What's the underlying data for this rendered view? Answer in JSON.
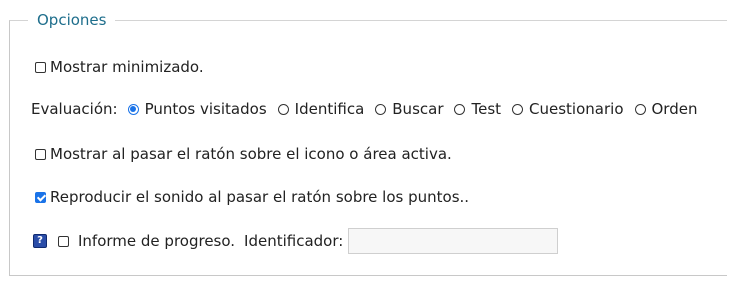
{
  "legend": "Opciones",
  "minimized": {
    "label": "Mostrar minimizado.",
    "checked": false
  },
  "evaluation": {
    "label": "Evaluación:",
    "options": [
      "Puntos visitados",
      "Identifica",
      "Buscar",
      "Test",
      "Cuestionario",
      "Orden"
    ],
    "selected": "Puntos visitados"
  },
  "hover_show": {
    "label": "Mostrar al pasar el ratón sobre el icono o área activa.",
    "checked": false
  },
  "hover_sound": {
    "label": "Reproducir el sonido al pasar el ratón sobre los puntos..",
    "checked": true
  },
  "progress": {
    "help_icon": "help-icon",
    "help_glyph": "?",
    "checkbox_label": "Informe de progreso.",
    "checked": false,
    "identifier_label": "Identificador:",
    "identifier_value": ""
  }
}
